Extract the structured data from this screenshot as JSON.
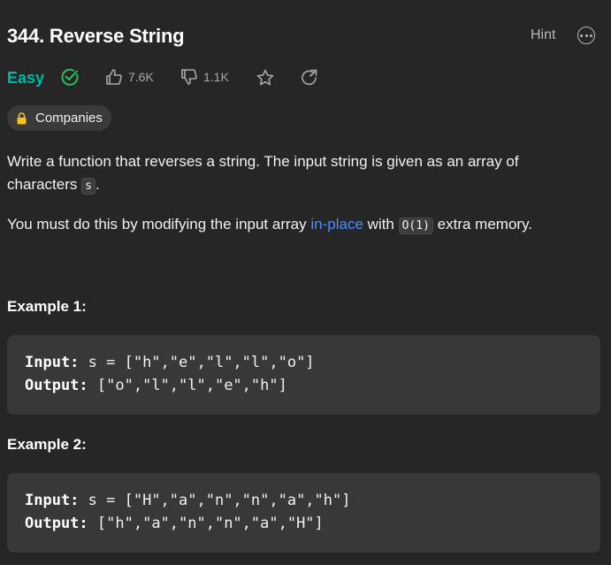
{
  "problem": {
    "title": "344. Reverse String",
    "difficulty": "Easy",
    "likes": "7.6K",
    "dislikes": "1.1K"
  },
  "header": {
    "hint_label": "Hint"
  },
  "tags": {
    "companies_label": "Companies"
  },
  "description": {
    "p1_text": "Write a function that reverses a string. The input string is given as an array of characters",
    "p1_code": "s",
    "p1_end": ".",
    "p2_text": "You must do this by modifying the input array",
    "p2_link": "in-place",
    "p2_mid": "with",
    "p2_code": "O(1)",
    "p2_end": "extra memory."
  },
  "examples": [
    {
      "title": "Example 1:",
      "input_label": "Input:",
      "input_value": "s = [\"h\",\"e\",\"l\",\"l\",\"o\"]",
      "output_label": "Output:",
      "output_value": "[\"o\",\"l\",\"l\",\"e\",\"h\"]"
    },
    {
      "title": "Example 2:",
      "input_label": "Input:",
      "input_value": "s = [\"H\",\"a\",\"n\",\"n\",\"a\",\"h\"]",
      "output_label": "Output:",
      "output_value": "[\"h\",\"a\",\"n\",\"n\",\"a\",\"H\"]"
    }
  ],
  "colors": {
    "background": "#262626",
    "easy": "#00b8a3",
    "link": "#4d8cf6",
    "example_bg": "#383838"
  },
  "icons": [
    "solved-check-icon",
    "thumbs-up-icon",
    "thumbs-down-icon",
    "star-icon",
    "share-icon",
    "lock-icon",
    "more-icon"
  ]
}
